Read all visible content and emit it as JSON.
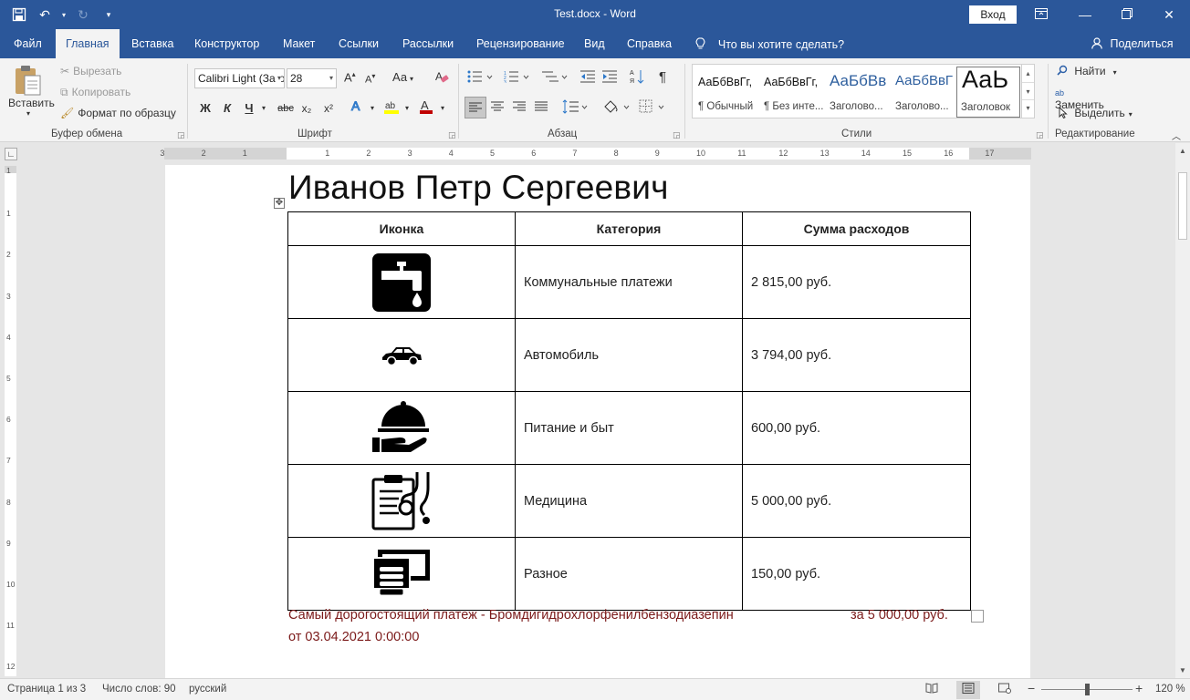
{
  "titlebar": {
    "title": "Test.docx  -  Word",
    "signin": "Вход",
    "qat": {
      "save_icon": "save-icon",
      "undo_icon": "undo-icon",
      "redo_icon": "redo-icon",
      "customize_icon": "customize-qat-icon"
    },
    "window_icons": {
      "ribbon_display": "ribbon-display-icon",
      "minimize": "minimize-icon",
      "maximize": "restore-icon",
      "close": "close-icon"
    }
  },
  "tabs": {
    "file": "Файл",
    "home": "Главная",
    "insert": "Вставка",
    "design": "Конструктор",
    "layout": "Макет",
    "references": "Ссылки",
    "mailings": "Рассылки",
    "review": "Рецензирование",
    "view": "Вид",
    "help": "Справка",
    "tell_me": "Что вы хотите сделать?",
    "share": "Поделиться"
  },
  "ribbon": {
    "clipboard": {
      "paste": "Вставить",
      "cut": "Вырезать",
      "copy": "Копировать",
      "format_painter": "Формат по образцу",
      "label": "Буфер обмена"
    },
    "font": {
      "font_name": "Calibri Light (Заголовки)",
      "font_size": "28",
      "case_button": "Аа",
      "bold": "Ж",
      "italic": "К",
      "underline": "Ч",
      "strike": "abc",
      "subscript": "x₂",
      "superscript": "x²",
      "label": "Шрифт",
      "highlight_color": "#ffff00",
      "font_color": "#c00000"
    },
    "paragraph": {
      "label": "Абзац",
      "pilcrow": "¶"
    },
    "styles": {
      "label": "Стили",
      "items": [
        {
          "sample": "АаБбВвГг,",
          "name": "¶ Обычный"
        },
        {
          "sample": "АаБбВвГг,",
          "name": "¶ Без инте..."
        },
        {
          "sample": "АаБбВв",
          "name": "Заголово..."
        },
        {
          "sample": "АаБбВвГ",
          "name": "Заголово..."
        },
        {
          "sample": "АаЬ",
          "name": "Заголовок"
        }
      ]
    },
    "editing": {
      "find": "Найти",
      "replace": "Заменить",
      "select": "Выделить",
      "label": "Редактирование"
    }
  },
  "ruler": {
    "h_numbers": [
      "3",
      "2",
      "1",
      "1",
      "2",
      "3",
      "4",
      "5",
      "6",
      "7",
      "8",
      "9",
      "10",
      "11",
      "12",
      "13",
      "14",
      "15",
      "16",
      "17"
    ],
    "v_numbers": [
      "1",
      "1",
      "2",
      "3",
      "4",
      "5",
      "6",
      "7",
      "8",
      "9",
      "10",
      "11",
      "12"
    ]
  },
  "document": {
    "heading": "Иванов Петр Сергеевич",
    "table": {
      "headers": [
        "Иконка",
        "Категория",
        "Сумма расходов"
      ],
      "rows": [
        {
          "icon": "water-tap-icon",
          "category": "Коммунальные платежи",
          "amount": "2 815,00 руб."
        },
        {
          "icon": "car-icon",
          "category": "Автомобиль",
          "amount": "3 794,00 руб."
        },
        {
          "icon": "food-service-icon",
          "category": "Питание и быт",
          "amount": "600,00 руб."
        },
        {
          "icon": "medical-clipboard-icon",
          "category": "Медицина",
          "amount": "5 000,00 руб."
        },
        {
          "icon": "money-icon",
          "category": "Разное",
          "amount": "150,00 руб."
        }
      ]
    },
    "summary_line1": "Самый дорогостоящий платеж - Бромдигидрохлорфенилбензодиазепин",
    "summary_amount": "за 5 000,00 руб.",
    "summary_line2": "от 03.04.2021 0:00:00",
    "summary_color": "#7b1a1a"
  },
  "status": {
    "page": "Страница 1 из 3",
    "words": "Число слов: 90",
    "language": "русский",
    "zoom": "120 %",
    "zoom_minus": "−",
    "zoom_plus": "+"
  }
}
